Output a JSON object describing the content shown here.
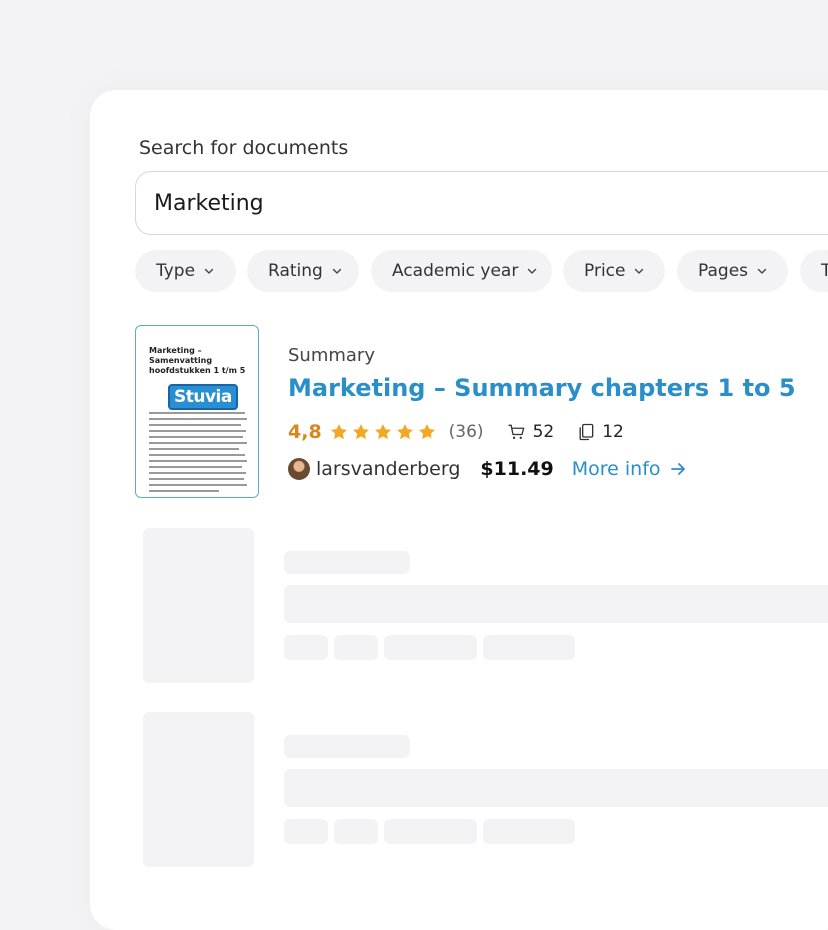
{
  "search": {
    "label": "Search for documents",
    "value": "Marketing"
  },
  "filters": [
    "Type",
    "Rating",
    "Academic year",
    "Price",
    "Pages",
    "T"
  ],
  "result": {
    "thumbnail_title": "Marketing – Samenvatting hoofdstukken 1 t/m 5",
    "thumbnail_logo": "Stuvia",
    "type": "Summary",
    "title": "Marketing – Summary chapters 1 to 5",
    "rating": "4,8",
    "stars": 4.8,
    "rating_count": "(36)",
    "sales": "52",
    "pages": "12",
    "author": "larsvanderberg",
    "price": "$11.49",
    "more_info": "More info"
  },
  "colors": {
    "accent": "#2a8fc9",
    "rating": "#d9871c",
    "star": "#f5a623"
  }
}
